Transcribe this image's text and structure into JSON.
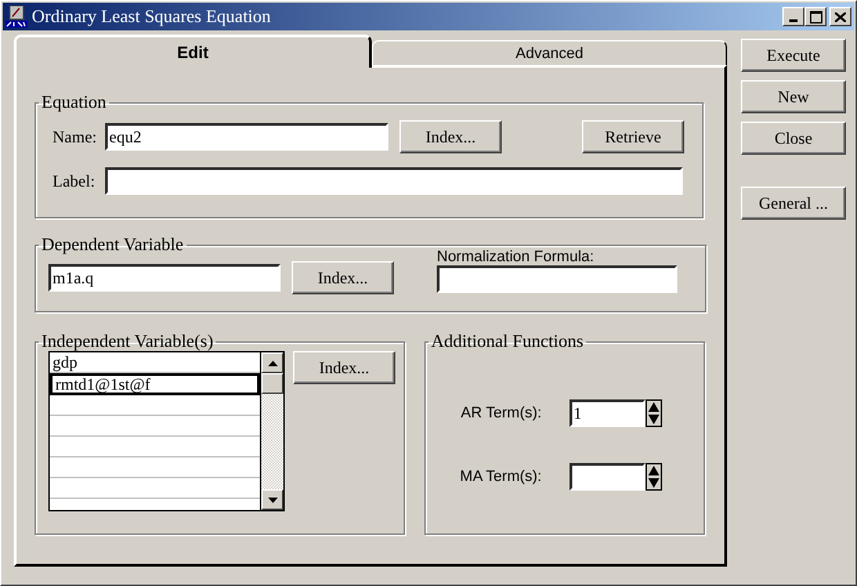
{
  "window": {
    "title": "Ordinary Least Squares Equation"
  },
  "tabs": [
    {
      "label": "Edit",
      "selected": true
    },
    {
      "label": "Advanced",
      "selected": false
    }
  ],
  "equation": {
    "title": "Equation",
    "name_label": "Name:",
    "name_value": "equ2",
    "index_button": "Index...",
    "retrieve_button": "Retrieve",
    "label_label": "Label:"
  },
  "dependent": {
    "title": "Dependent Variable",
    "value": "m1a.q",
    "index_button": "Index...",
    "normalization_label": "Normalization Formula:"
  },
  "independent": {
    "title": "Independent Variable(s)",
    "items": [
      {
        "label": "gdp",
        "selected": false
      },
      {
        "label": "rmtd1@1st@f",
        "selected": true
      }
    ],
    "index_button": "Index..."
  },
  "additional": {
    "title": "Additional Functions",
    "ar_label": "AR Term(s):",
    "ar_value": "1",
    "ma_label": "MA Term(s):"
  },
  "side_buttons": [
    "Execute",
    "New",
    "Close",
    "General ..."
  ]
}
